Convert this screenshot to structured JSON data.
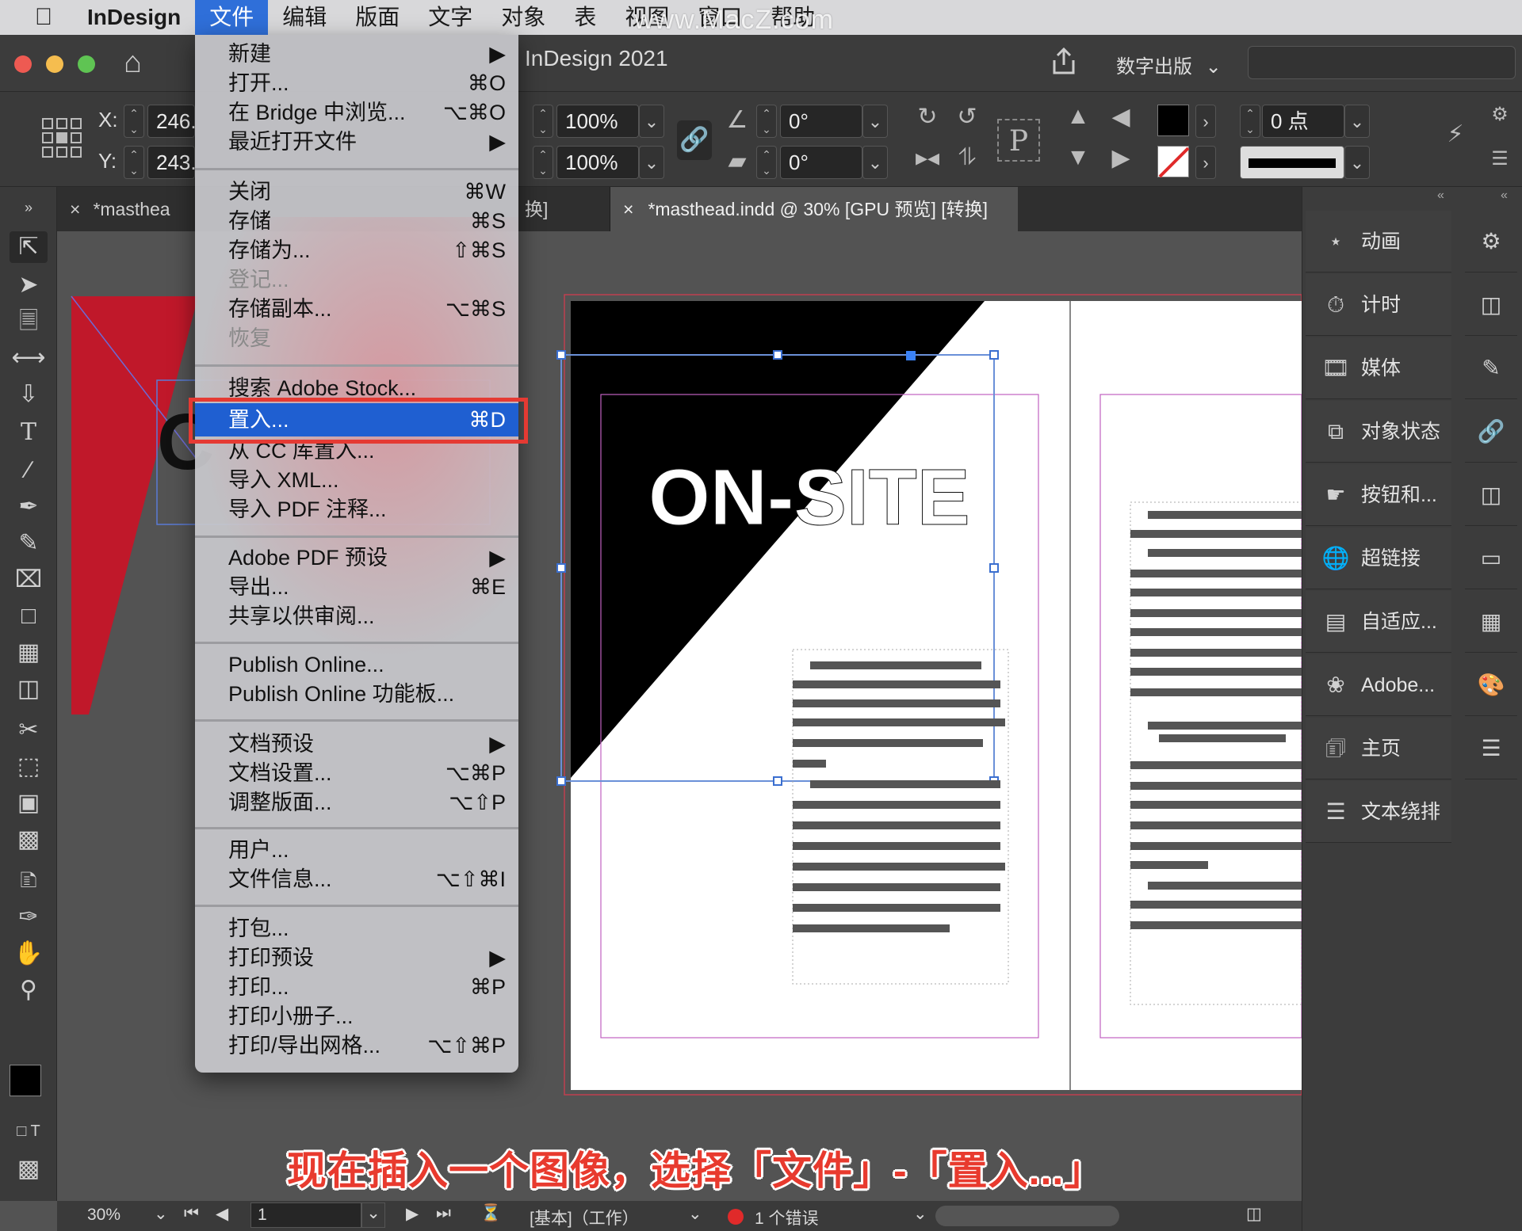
{
  "menubar": {
    "apple": "",
    "app_name": "InDesign",
    "items": [
      "文件",
      "编辑",
      "版面",
      "文字",
      "对象",
      "表",
      "视图",
      "窗口",
      "帮助"
    ]
  },
  "watermark": "www.MacZ.com",
  "window": {
    "title": "InDesign 2021"
  },
  "topbar": {
    "workspace": "数字出版"
  },
  "control": {
    "x_label": "X:",
    "x_value": "246.",
    "y_label": "Y:",
    "y_value": "243.",
    "scale_x": "100%",
    "scale_y": "100%",
    "rotate": "0°",
    "shear": "0°",
    "stroke_weight": "0 点"
  },
  "tabs": [
    {
      "label": "*masthea"
    },
    {
      "label": "换]"
    },
    {
      "label": "*masthead.indd @ 30% [GPU 预览] [转换]"
    }
  ],
  "file_menu": {
    "groups": [
      [
        {
          "label": "新建",
          "shortcut": "▶"
        },
        {
          "label": "打开...",
          "shortcut": "⌘O"
        },
        {
          "label": "在 Bridge 中浏览...",
          "shortcut": "⌥⌘O"
        },
        {
          "label": "最近打开文件",
          "shortcut": "▶"
        }
      ],
      [
        {
          "label": "关闭",
          "shortcut": "⌘W"
        },
        {
          "label": "存储",
          "shortcut": "⌘S"
        },
        {
          "label": "存储为...",
          "shortcut": "⇧⌘S"
        },
        {
          "label": "登记...",
          "shortcut": "",
          "disabled": true
        },
        {
          "label": "存储副本...",
          "shortcut": "⌥⌘S"
        },
        {
          "label": "恢复",
          "shortcut": "",
          "disabled": true
        }
      ],
      [
        {
          "label": "搜索 Adobe Stock...",
          "shortcut": ""
        },
        {
          "label": "置入...",
          "shortcut": "⌘D",
          "highlighted": true
        },
        {
          "label": "从 CC 库置入...",
          "shortcut": ""
        },
        {
          "label": "导入 XML...",
          "shortcut": ""
        },
        {
          "label": "导入 PDF 注释...",
          "shortcut": ""
        }
      ],
      [
        {
          "label": "Adobe PDF 预设",
          "shortcut": "▶"
        },
        {
          "label": "导出...",
          "shortcut": "⌘E"
        },
        {
          "label": "共享以供审阅...",
          "shortcut": ""
        }
      ],
      [
        {
          "label": "Publish Online...",
          "shortcut": ""
        },
        {
          "label": "Publish Online 功能板...",
          "shortcut": ""
        }
      ],
      [
        {
          "label": "文档预设",
          "shortcut": "▶"
        },
        {
          "label": "文档设置...",
          "shortcut": "⌥⌘P"
        },
        {
          "label": "调整版面...",
          "shortcut": "⌥⇧P"
        }
      ],
      [
        {
          "label": "用户...",
          "shortcut": ""
        },
        {
          "label": "文件信息...",
          "shortcut": "⌥⇧⌘I"
        }
      ],
      [
        {
          "label": "打包...",
          "shortcut": ""
        },
        {
          "label": "打印预设",
          "shortcut": "▶"
        },
        {
          "label": "打印...",
          "shortcut": "⌘P"
        },
        {
          "label": "打印小册子...",
          "shortcut": ""
        },
        {
          "label": "打印/导出网格...",
          "shortcut": "⌥⇧⌘P"
        }
      ]
    ]
  },
  "panels": [
    {
      "label": "动画",
      "icon": "animation-icon"
    },
    {
      "label": "计时",
      "icon": "timer-icon"
    },
    {
      "label": "媒体",
      "icon": "media-icon"
    },
    {
      "label": "对象状态",
      "icon": "object-states-icon"
    },
    {
      "label": "按钮和...",
      "icon": "buttons-icon"
    },
    {
      "label": "超链接",
      "icon": "hyperlinks-icon"
    },
    {
      "label": "自适应...",
      "icon": "liquid-layout-icon"
    },
    {
      "label": "Adobe...",
      "icon": "adobe-icon"
    },
    {
      "label": "主页",
      "icon": "pages-icon"
    },
    {
      "label": "文本绕排",
      "icon": "text-wrap-icon"
    }
  ],
  "document": {
    "headline": "ON-SITE",
    "left_letter": "C"
  },
  "status": {
    "zoom": "30%",
    "page": "1",
    "preflight_profile": "[基本]（工作）",
    "errors": "1 个错误"
  },
  "caption": "现在插入一个图像，选择「文件」-「置入...」",
  "colors": {
    "menu_highlight": "#1f5fd1",
    "callout_red": "#e53a33",
    "doc_red": "#c0182a"
  }
}
